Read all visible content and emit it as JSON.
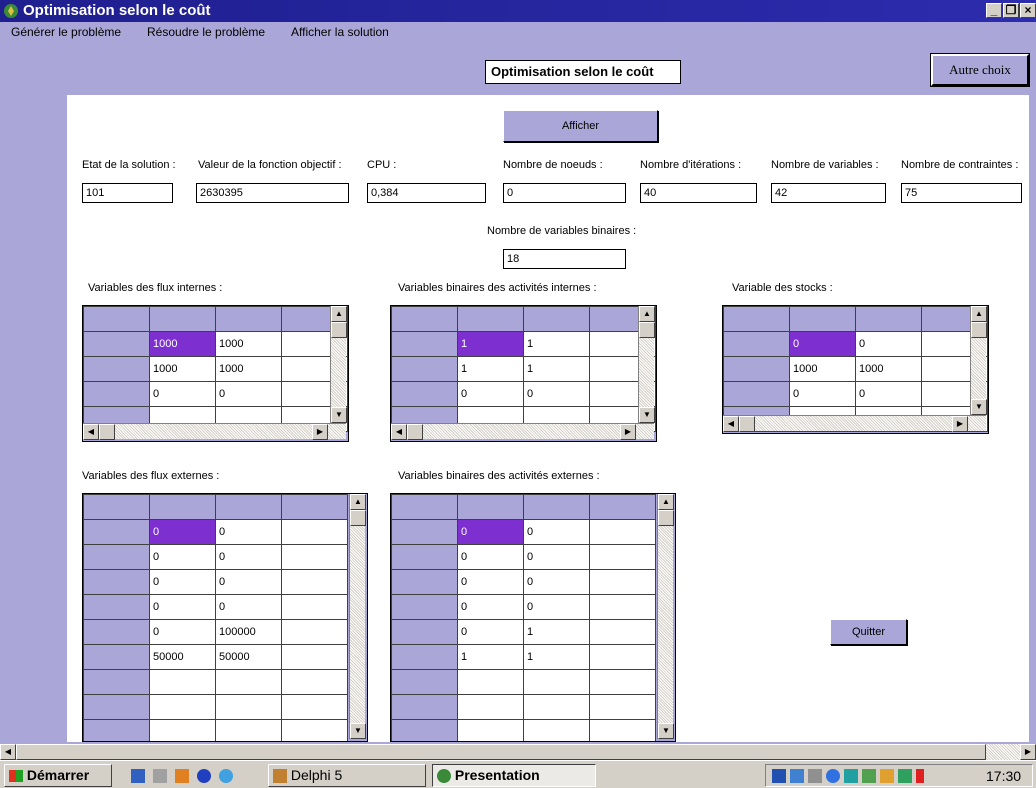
{
  "window": {
    "title": "Optimisation selon le coût"
  },
  "menu": [
    "Générer le problème",
    "Résoudre le problème",
    "Afficher la solution"
  ],
  "heading": "Optimisation selon le coût",
  "autre_choix": "Autre choix",
  "afficher": "Afficher",
  "quitter": "Quitter",
  "stats": {
    "etat_label": "Etat de la solution :",
    "etat_value": "101",
    "objectif_label": "Valeur de la fonction objectif :",
    "objectif_value": "2630395",
    "cpu_label": "CPU :",
    "cpu_value": "0,384",
    "noeuds_label": "Nombre de noeuds :",
    "noeuds_value": "0",
    "iterations_label": "Nombre d'itérations :",
    "iterations_value": "40",
    "variables_label": "Nombre de variables :",
    "variables_value": "42",
    "contraintes_label": "Nombre de contraintes :",
    "contraintes_value": "75",
    "binaires_label": "Nombre de variables binaires :",
    "binaires_value": "18"
  },
  "grids": {
    "flux_internes": {
      "label": "Variables des flux internes :",
      "rows": [
        [
          "1000",
          "1000"
        ],
        [
          "1000",
          "1000"
        ],
        [
          "0",
          "0"
        ],
        [
          "",
          ""
        ]
      ]
    },
    "binaires_internes": {
      "label": "Variables binaires des activités internes :",
      "rows": [
        [
          "1",
          "1"
        ],
        [
          "1",
          "1"
        ],
        [
          "0",
          "0"
        ],
        [
          "",
          ""
        ]
      ]
    },
    "stocks": {
      "label": "Variable des stocks :",
      "rows": [
        [
          "0",
          "0"
        ],
        [
          "1000",
          "1000"
        ],
        [
          "0",
          "0"
        ],
        [
          "",
          ""
        ]
      ]
    },
    "flux_externes": {
      "label": "Variables des flux externes :",
      "rows": [
        [
          "0",
          "0"
        ],
        [
          "0",
          "0"
        ],
        [
          "0",
          "0"
        ],
        [
          "0",
          "0"
        ],
        [
          "0",
          "100000"
        ],
        [
          "50000",
          "50000"
        ],
        [
          "",
          ""
        ],
        [
          "",
          ""
        ],
        [
          "",
          ""
        ]
      ]
    },
    "binaires_externes": {
      "label": "Variables binaires des activités externes :",
      "rows": [
        [
          "0",
          "0"
        ],
        [
          "0",
          "0"
        ],
        [
          "0",
          "0"
        ],
        [
          "0",
          "0"
        ],
        [
          "0",
          "1"
        ],
        [
          "1",
          "1"
        ],
        [
          "",
          ""
        ],
        [
          "",
          ""
        ],
        [
          "",
          ""
        ]
      ]
    }
  },
  "taskbar": {
    "start": "Démarrer",
    "tasks": [
      "Delphi 5",
      "Presentation"
    ],
    "clock": "17:30"
  },
  "colors": {
    "accent": "#aaa7d8",
    "selection": "#7d2fd0",
    "titlebar": "#2424a0"
  }
}
